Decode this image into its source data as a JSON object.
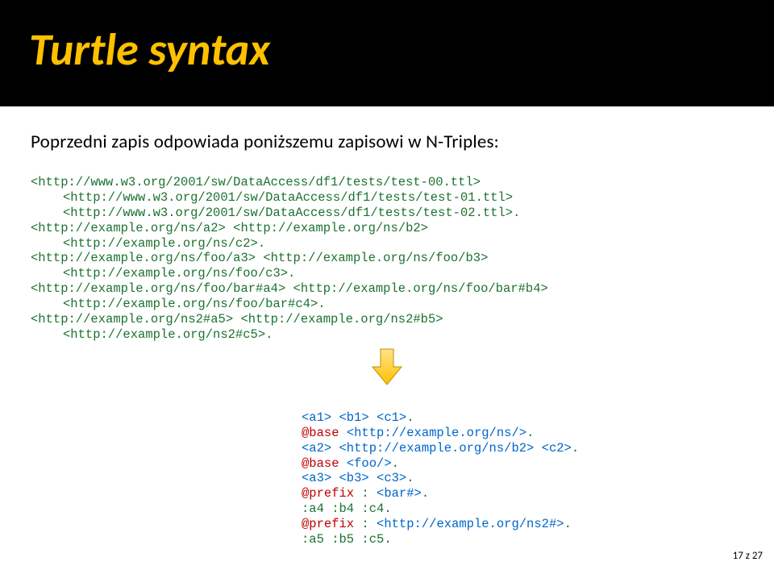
{
  "title": "Turtle syntax",
  "intro": "Poprzedni zapis odpowiada poniższemu zapisowi w N-Triples:",
  "code1": {
    "l1": "<http://www.w3.org/2001/sw/DataAccess/df1/tests/test-00.ttl>",
    "l2": "<http://www.w3.org/2001/sw/DataAccess/df1/tests/test-01.ttl>",
    "l3": "<http://www.w3.org/2001/sw/DataAccess/df1/tests/test-02.ttl>.",
    "l4": "<http://example.org/ns/a2> <http://example.org/ns/b2>",
    "l5": "<http://example.org/ns/c2>.",
    "l6": "<http://example.org/ns/foo/a3> <http://example.org/ns/foo/b3>",
    "l7": "<http://example.org/ns/foo/c3>.",
    "l8": "<http://example.org/ns/foo/bar#a4> <http://example.org/ns/foo/bar#b4>",
    "l9": "<http://example.org/ns/foo/bar#c4>.",
    "l10": "<http://example.org/ns2#a5> <http://example.org/ns2#b5>",
    "l11": "<http://example.org/ns2#c5>."
  },
  "code2": {
    "l1a": "<a1> <b1> <c1>",
    "l1b": ".",
    "l2a": "@base",
    "l2b": " <http://example.org/ns/>",
    "l2c": ".",
    "l3a": "<a2> <http://example.org/ns/b2> <c2>",
    "l3b": ".",
    "l4a": "@base",
    "l4b": " <foo/>",
    "l4c": ".",
    "l5a": "<a3> <b3> <c3>",
    "l5b": ".",
    "l6a": "@prefix",
    "l6b": " : ",
    "l6c": "<bar#>",
    "l6d": ".",
    "l7a": ":a4 :b4 :c4",
    "l7b": ".",
    "l8a": "@prefix",
    "l8b": " : ",
    "l8c": "<http://example.org/ns2#>",
    "l8d": ".",
    "l9a": ":a5 :b5 :c5",
    "l9b": "."
  },
  "pagenum": "17 z 27"
}
